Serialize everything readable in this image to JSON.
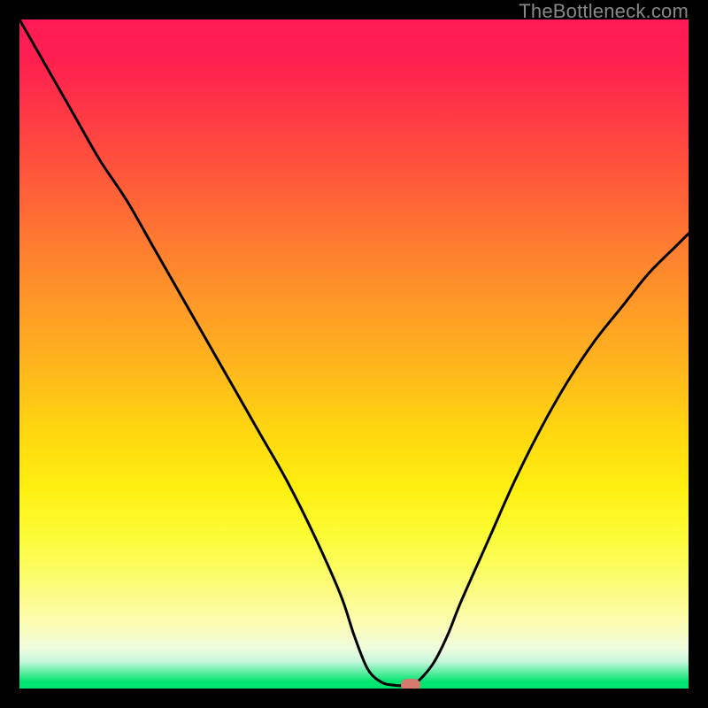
{
  "watermark": "TheBottleneck.com",
  "chart_data": {
    "type": "line",
    "title": "",
    "xlabel": "",
    "ylabel": "",
    "xlim": [
      0,
      100
    ],
    "ylim": [
      0,
      100
    ],
    "series": [
      {
        "name": "bottleneck-curve",
        "x": [
          0,
          4,
          8,
          12,
          16,
          20,
          24,
          28,
          32,
          36,
          40,
          44,
          48,
          50,
          52,
          54,
          56,
          58.5,
          60,
          62,
          64,
          66,
          70,
          74,
          78,
          82,
          86,
          90,
          94,
          98,
          100
        ],
        "values": [
          100,
          93,
          86,
          79,
          73,
          66,
          59,
          52,
          45,
          38,
          31,
          23,
          14,
          8,
          3,
          1,
          0.5,
          0.5,
          1.5,
          4,
          8,
          13,
          22,
          31,
          39,
          46,
          52,
          57,
          62,
          66,
          68
        ]
      }
    ],
    "marker": {
      "x": 58.5,
      "y": 0.5,
      "label": "optimal-point"
    },
    "background_gradient": {
      "stops": [
        {
          "pos": 0,
          "color": "#ff1a56"
        },
        {
          "pos": 50,
          "color": "#ffb01f"
        },
        {
          "pos": 77,
          "color": "#fcfc35"
        },
        {
          "pos": 100,
          "color": "#00e470"
        }
      ]
    }
  }
}
